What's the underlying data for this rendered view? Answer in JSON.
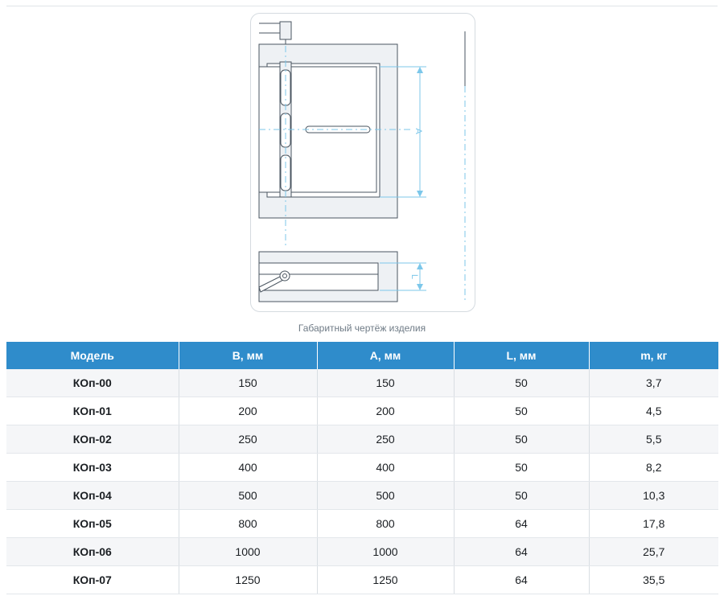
{
  "figure": {
    "caption": "Габаритный чертёж изделия",
    "dim_a_label": "A",
    "dim_l_label": "L"
  },
  "table": {
    "headers": [
      "Модель",
      "B, мм",
      "A, мм",
      "L, мм",
      "m, кг"
    ],
    "rows": [
      [
        "КОп-00",
        "150",
        "150",
        "50",
        "3,7"
      ],
      [
        "КОп-01",
        "200",
        "200",
        "50",
        "4,5"
      ],
      [
        "КОп-02",
        "250",
        "250",
        "50",
        "5,5"
      ],
      [
        "КОп-03",
        "400",
        "400",
        "50",
        "8,2"
      ],
      [
        "КОп-04",
        "500",
        "500",
        "50",
        "10,3"
      ],
      [
        "КОп-05",
        "800",
        "800",
        "64",
        "17,8"
      ],
      [
        "КОп-06",
        "1000",
        "1000",
        "64",
        "25,7"
      ],
      [
        "КОп-07",
        "1250",
        "1250",
        "64",
        "35,5"
      ]
    ]
  },
  "colors": {
    "header_bg": "#2f8ccb",
    "dimension_line": "#7cc7ea",
    "drawing_stroke": "#4a5560",
    "drawing_fill": "#eef1f4"
  }
}
